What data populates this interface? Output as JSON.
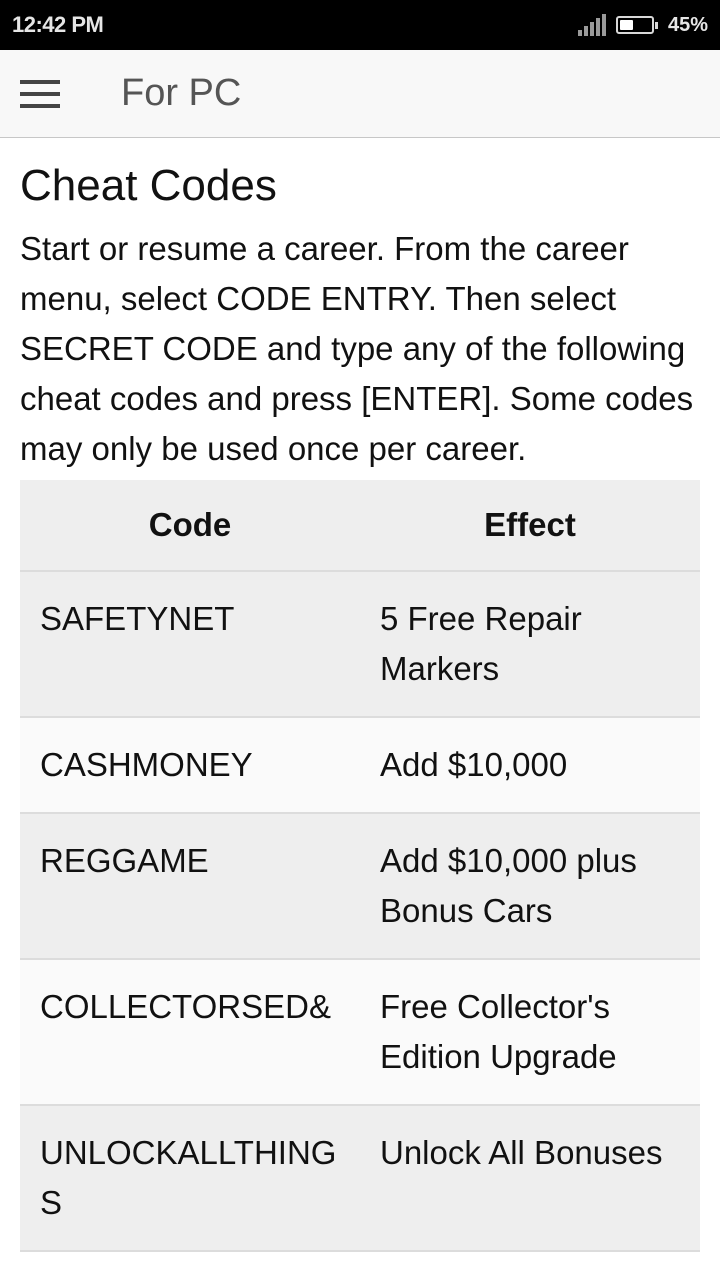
{
  "status_bar": {
    "time": "12:42 PM",
    "signal_icon": "cellular-signal-icon",
    "battery_icon": "battery-icon",
    "battery_level": 0.45,
    "battery_percent": "45%"
  },
  "app_bar": {
    "menu_icon": "hamburger-menu-icon",
    "title": "For PC"
  },
  "main": {
    "heading": "Cheat Codes",
    "intro": "Start or resume a career. From the career menu, select CODE ENTRY. Then select SECRET CODE and type any of the following cheat codes and press [ENTER]. Some codes may only be used once per career.",
    "table": {
      "headers": [
        "Code",
        "Effect"
      ],
      "rows": [
        {
          "code": "SAFETYNET",
          "effect": "5 Free Repair Markers"
        },
        {
          "code": "CASHMONEY",
          "effect": "Add $10,000"
        },
        {
          "code": "REGGAME",
          "effect": "Add $10,000 plus Bonus Cars"
        },
        {
          "code": "COLLECTORSED&",
          "effect": "Free Collector's Edition Upgrade"
        },
        {
          "code": "UNLOCKALLTHINGS",
          "effect": "Unlock All Bonuses"
        }
      ]
    }
  }
}
